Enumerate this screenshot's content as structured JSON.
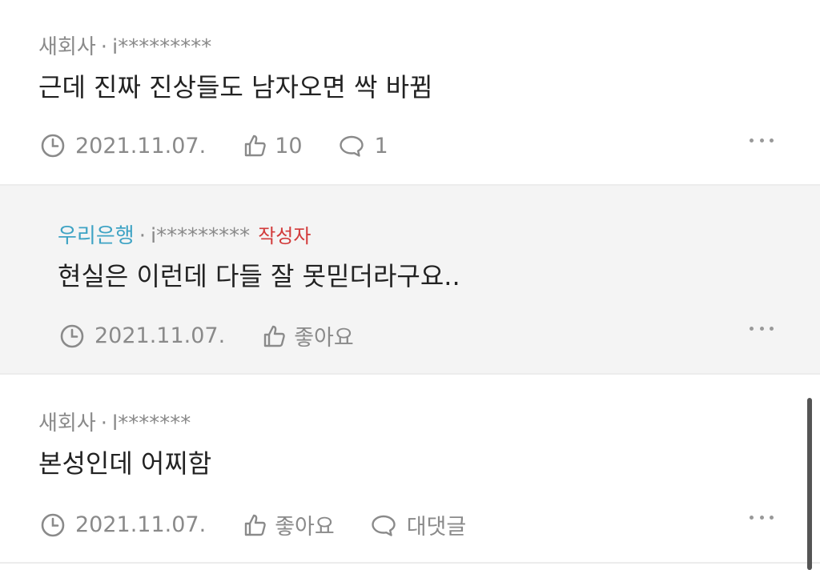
{
  "comments": [
    {
      "org": "새회사",
      "separator": "·",
      "user": "i*********",
      "text": "근데 진짜 진상들도 남자오면 싹 바뀜",
      "date": "2021.11.07.",
      "likes": "10",
      "replies": "1"
    },
    {
      "org": "우리은행",
      "separator": "·",
      "user": "i*********",
      "author_badge": "작성자",
      "text": "현실은 이런데 다들 잘 못믿더라구요..",
      "date": "2021.11.07.",
      "likes": "좋아요"
    },
    {
      "org": "새회사",
      "separator": "·",
      "user": "l*******",
      "text": "본성인데 어찌함",
      "date": "2021.11.07.",
      "likes": "좋아요",
      "replies": "대댓글"
    }
  ],
  "icons": {
    "clock": "clock-icon",
    "like": "thumbs-up-icon",
    "reply": "speech-bubble-icon",
    "more": "more-dots-icon"
  },
  "colors": {
    "meta_gray": "#8a8a8a",
    "org_highlight": "#3ea3c4",
    "author_badge": "#d23a3a",
    "reply_background": "#f4f4f4"
  }
}
